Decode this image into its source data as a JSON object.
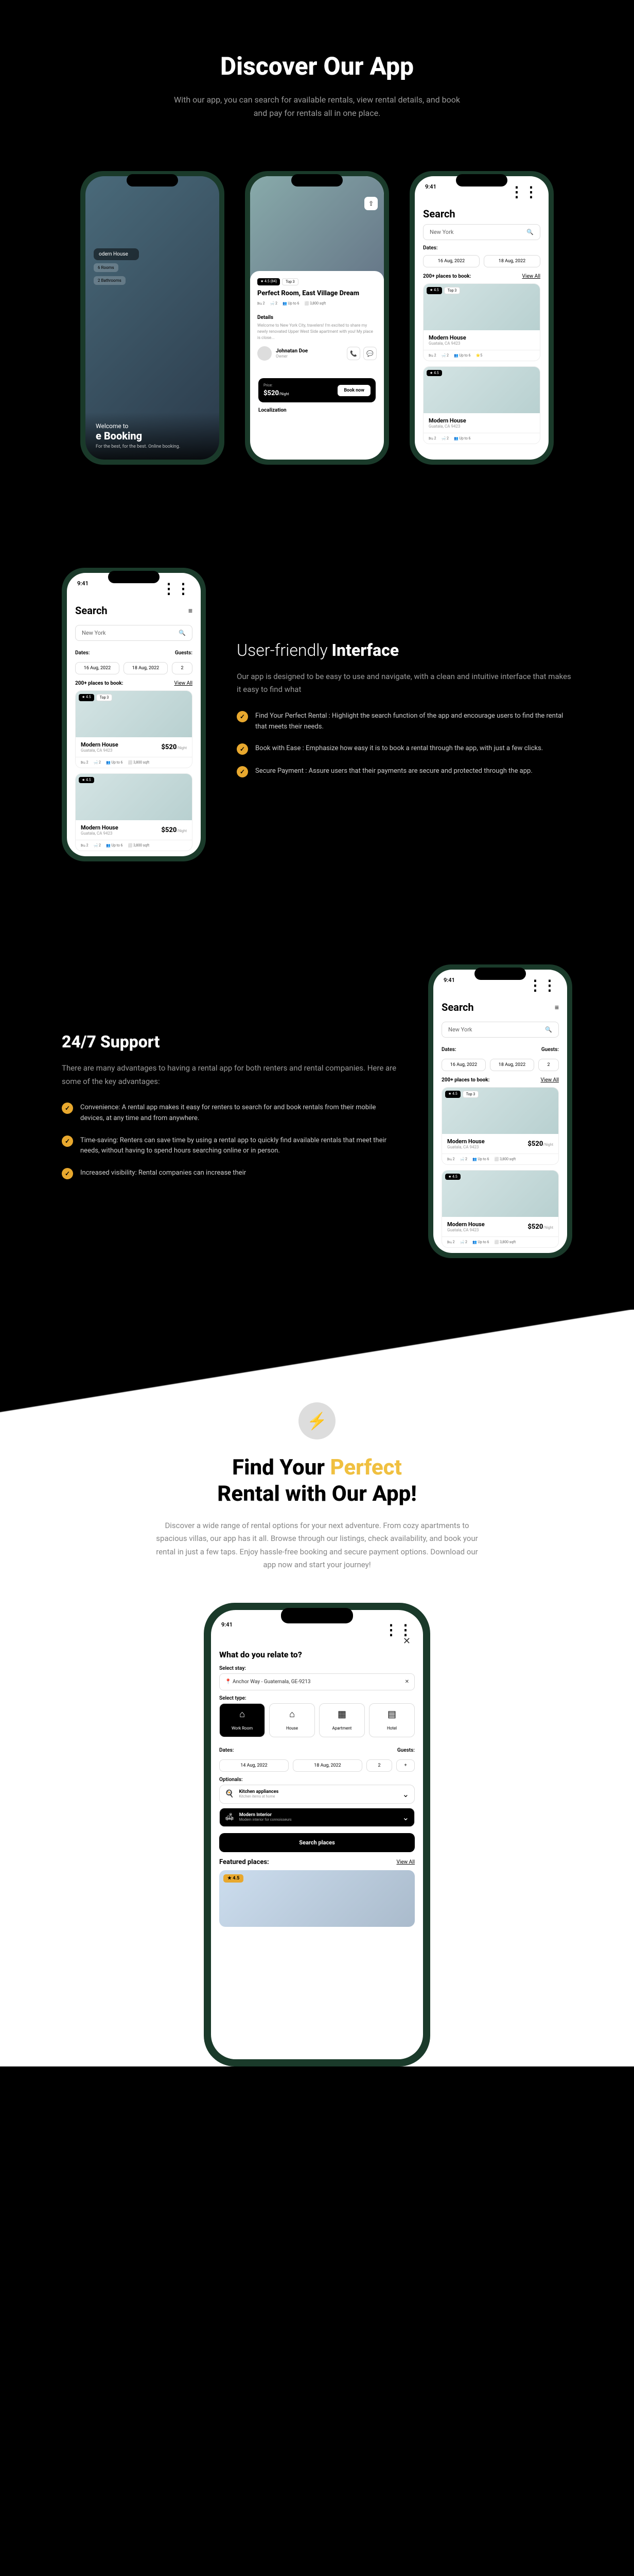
{
  "hero": {
    "title": "Discover Our App",
    "subtitle": "With our app, you can search for available rentals, view rental details, and book and pay for rentals all in one place."
  },
  "status": {
    "time": "9:41"
  },
  "search": {
    "title": "Search",
    "location": "New York",
    "dates_label": "Dates:",
    "guests_label": "Guests:",
    "date1": "16 Aug, 2022",
    "date2": "18 Aug, 2022",
    "guests": "2",
    "places": "200+ places to book:",
    "view_all": "View All"
  },
  "listing": {
    "name": "Modern House",
    "location": "Guatala, CA 9423",
    "price": "$520",
    "night": "/Night",
    "rating": "★ 4.5",
    "top": "Top 3",
    "beds": "🛏 2",
    "baths": "🛁 2",
    "guests_m": "👥 Up to 6",
    "area": "⬜ 3,800 sqft"
  },
  "detail": {
    "rating": "★ 4.5 (84)",
    "top": "Top 3",
    "title": "Perfect Room, East Village Dream",
    "section": "Details",
    "desc": "Welcome to New York City, travelers! I'm excited to share my newly renovated Upper West Side apartment with you! My place is close...",
    "author": "Johnatan Doe",
    "role": "Owner",
    "price_label": "Price:",
    "price": "$520",
    "night": "/Night",
    "book": "Book now",
    "loc_section": "Localization"
  },
  "booking": {
    "welcome": "Welcome to",
    "title": "e Booking",
    "sub": "For the best, for the best. Online booking.",
    "house": "odern House",
    "rooms": "6 Rooms",
    "baths": "2 Bathrooms"
  },
  "feature1": {
    "title_light": "User-friendly",
    "title_bold": "Interface",
    "desc": "Our app is designed to be easy to use and navigate, with a clean and intuitive interface that makes it easy to find what",
    "items": [
      "Find Your Perfect Rental : Highlight the search function of the app and encourage users to find the rental that meets their needs.",
      "Book with Ease : Emphasize how easy it is to book a rental through the app, with just a few clicks.",
      "Secure Payment : Assure users that their payments are secure and protected through the app."
    ]
  },
  "feature2": {
    "title": "24/7 Support",
    "desc": "There are many advantages to having a rental app for both renters and rental companies. Here are some of the key advantages:",
    "items": [
      "Convenience: A rental app makes it easy for renters to search for and book rentals from their mobile devices, at any time and from anywhere.",
      "Time-saving: Renters can save time by using a rental app to quickly find available rentals that meet their needs, without having to spend hours searching online or in person.",
      "Increased visibility: Rental companies can increase their"
    ]
  },
  "cta": {
    "line1_a": "Find Your",
    "line1_b": "Perfect",
    "line2": "Rental with Our App!",
    "desc": "Discover a wide range of rental options for your next adventure. From cozy apartments to spacious villas, our app has it all. Browse through our listings, check availability, and book your rental in just a few taps. Enjoy hassle-free booking and secure payment options. Download our app now and start your journey!"
  },
  "relate": {
    "title": "What do you relate to?",
    "stay_label": "Select stay:",
    "stay": "Anchor Way - Guatemala, GE-9213",
    "type_label": "Select type:",
    "types": [
      {
        "icon": "⌂",
        "label": "Work Room"
      },
      {
        "icon": "⌂",
        "label": "House"
      },
      {
        "icon": "▦",
        "label": "Apartment"
      },
      {
        "icon": "▤",
        "label": "Hotel"
      }
    ],
    "dates_label": "Dates:",
    "date1": "14 Aug, 2022",
    "date2": "18 Aug, 2022",
    "guests": "2",
    "opt_label": "Optionals:",
    "opts": [
      {
        "icon": "🍳",
        "title": "Kitchen appliances",
        "sub": "Kitchen items at home"
      },
      {
        "icon": "🛋",
        "title": "Modern Interior",
        "sub": "Modern interior for connoisseurs"
      }
    ],
    "search_btn": "Search places",
    "featured": "Featured places:",
    "view_all": "View All",
    "rating": "★ 4.5"
  }
}
